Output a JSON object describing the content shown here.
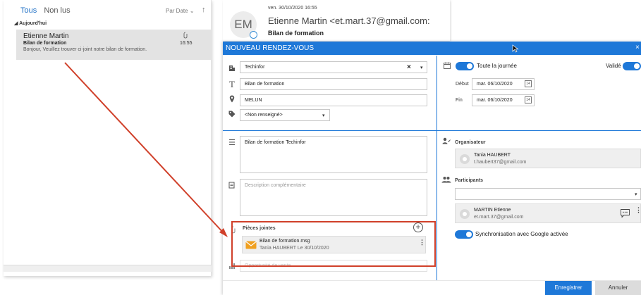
{
  "mail_list": {
    "tabs": [
      "Tous",
      "Non lus"
    ],
    "sort_label": "Par Date",
    "sort_caret": "⌄",
    "sort_arrow": "↑",
    "group_header": "Aujourd'hui",
    "item": {
      "sender": "Etienne Martin",
      "subject": "Bilan de formation",
      "preview": "Bonjour,  Veuillez trouver ci-joint notre bilan de formation.",
      "time": "16:55",
      "attachment_icon": "paperclip-icon"
    }
  },
  "reading": {
    "avatar_initials": "EM",
    "date": "ven. 30/10/2020 16:55",
    "from": "Etienne Martin <et.mart.37@gmail.com:",
    "subject": "Bilan de formation"
  },
  "dialog": {
    "title": "NOUVEAU RENDEZ-VOUS",
    "close_label": "×",
    "company": "Techinfor",
    "company_clear": "×",
    "company_caret": "▾",
    "subject": "Bilan de formation",
    "location": "MELUN",
    "category": "<Non renseigné>",
    "category_caret": "▾",
    "all_day_label": "Toute la journée",
    "validated_label": "Validé",
    "start_label": "Début",
    "start_date": "mar.  06/10/2020",
    "end_label": "Fin",
    "end_date": "mar.  06/10/2020",
    "calendar_glyph": "14",
    "description": "Bilan de formation Techinfor",
    "extra_description_placeholder": "Description complémentaire",
    "attachments_title": "Pièces jointes",
    "attachment_add": "+",
    "attachment_file": "Bilan de formation.msg",
    "attachment_meta": "Tania HAUBERT Le 30/10/2020",
    "attachment_menu": "⋮",
    "opportunity_placeholder": "Opportunité de vente",
    "organizer_title": "Organisateur",
    "organizer_name": "Tania HAUBERT",
    "organizer_email": "t.haubert37@gmail.com",
    "participants_title": "Participants",
    "participant_caret": "▾",
    "participant_name": "MARTIN Etienne",
    "participant_email": "et.mart.37@gmail.com",
    "participant_menu": "⋮",
    "google_sync_label": "Synchronisation avec Google activée",
    "save_label": "Enregistrer",
    "cancel_label": "Annuler"
  },
  "colors": {
    "accent": "#1e78d8",
    "annotation": "#d0402a",
    "attachment_icon": "#f0a020"
  },
  "icons": [
    "building-icon",
    "text-icon",
    "location-icon",
    "tag-icon",
    "calendar-icon",
    "lines-icon",
    "description-icon",
    "paperclip-icon",
    "chart-icon",
    "organizer-icon",
    "participants-icon",
    "envelope-icon",
    "chat-icon",
    "add-icon",
    "cursor-icon"
  ]
}
